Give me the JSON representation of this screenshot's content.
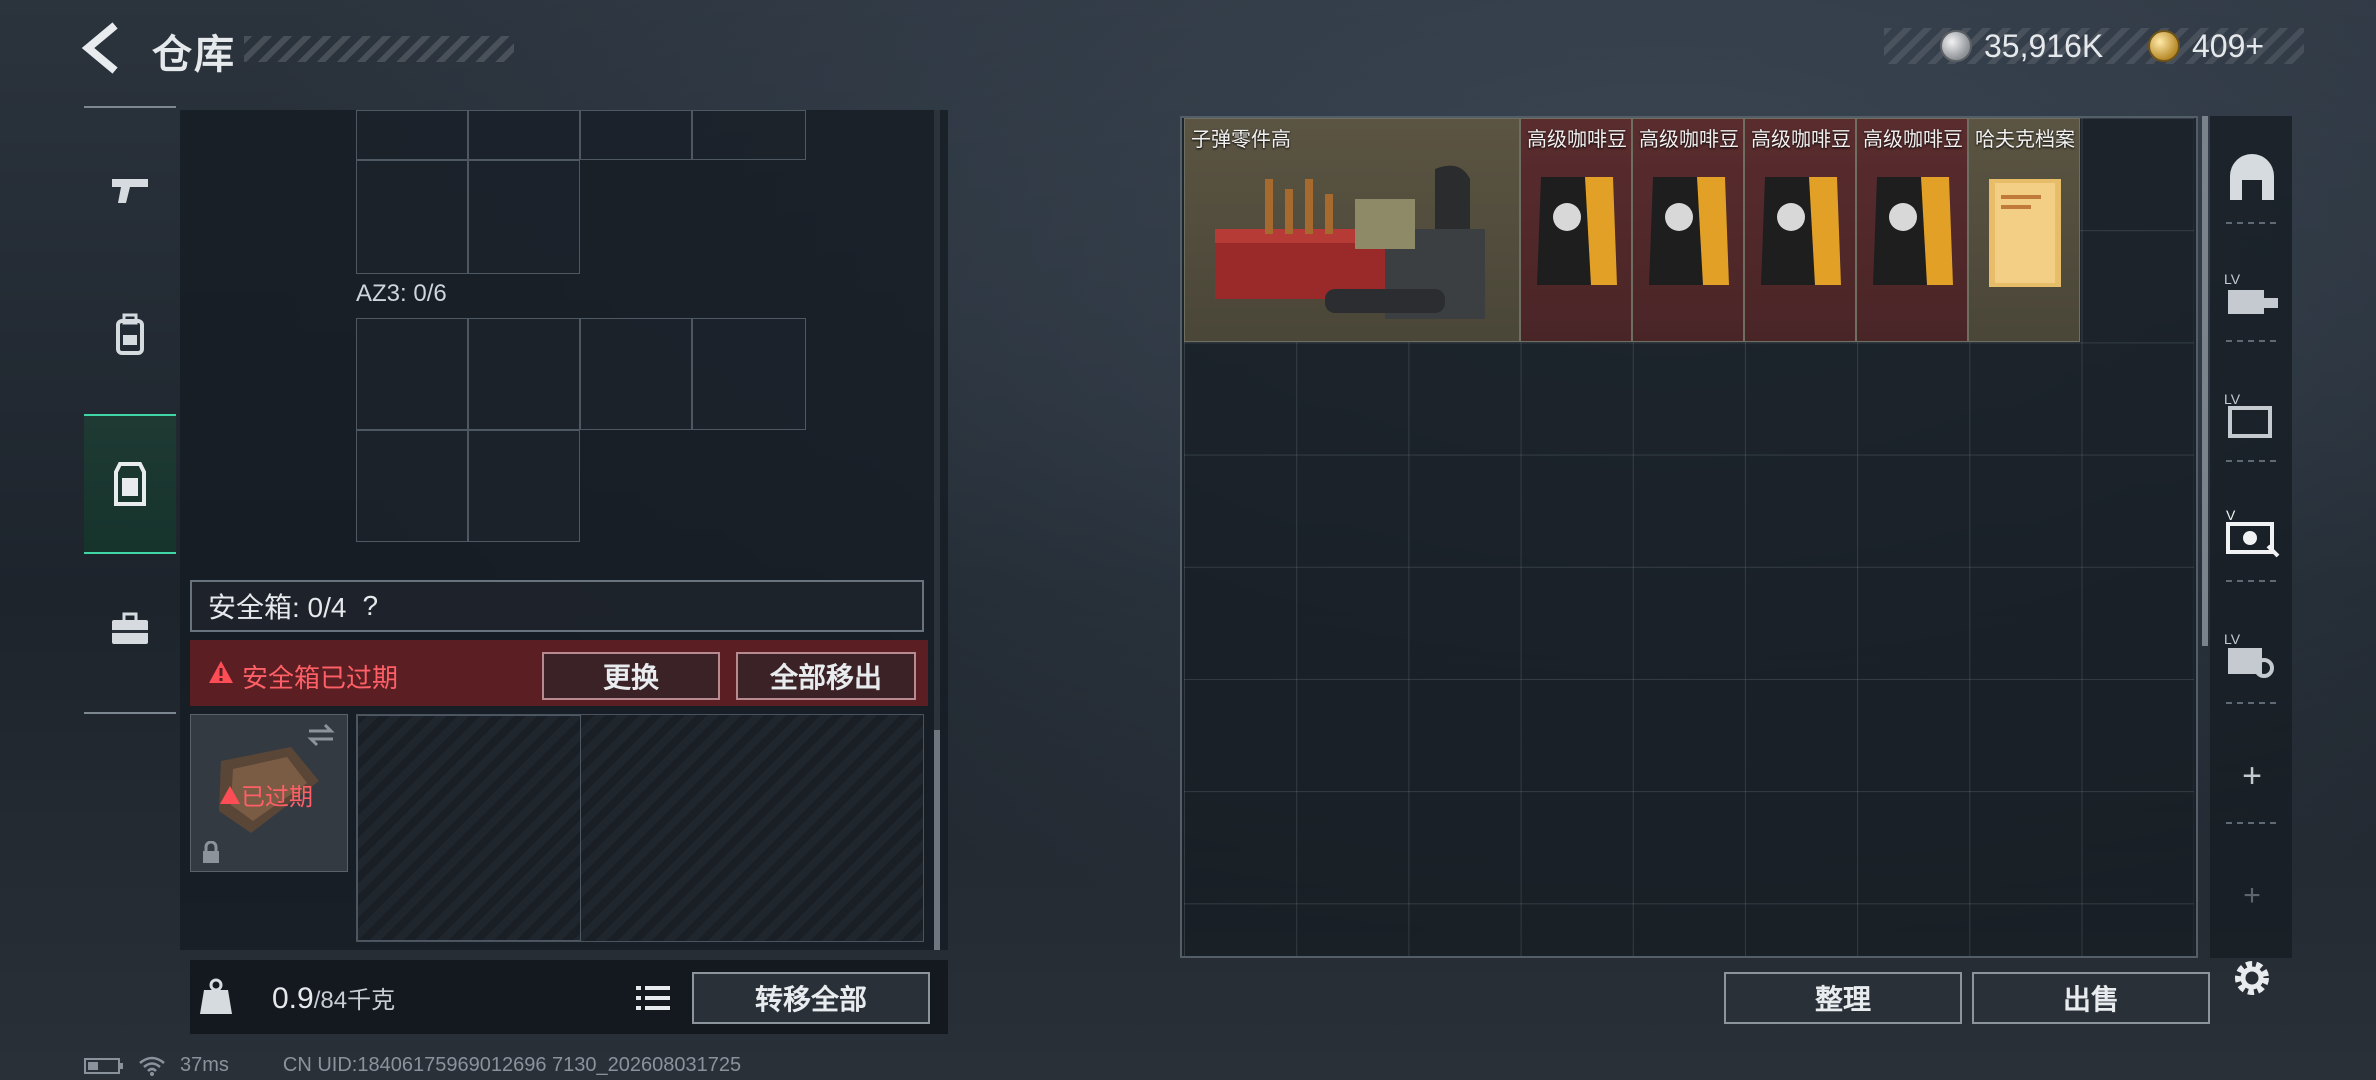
{
  "header": {
    "title": "仓库",
    "currency_silver": "35,916K",
    "currency_gold": "409+"
  },
  "left_tabs": [
    {
      "name": "weapon",
      "icon": "pistol-icon"
    },
    {
      "name": "gear",
      "icon": "backpack-icon"
    },
    {
      "name": "container",
      "icon": "vest-icon",
      "active": true
    },
    {
      "name": "case",
      "icon": "briefcase-icon"
    }
  ],
  "container": {
    "az3_label": "AZ3: 0/6",
    "safebox_label": "安全箱: 0/4",
    "safebox_help": "?",
    "expired_warning": "安全箱已过期",
    "replace_button": "更换",
    "move_all_out_button": "全部移出",
    "case_expired_label": "已过期"
  },
  "footer_left": {
    "weight_value": "0.9",
    "weight_max": "/84千克",
    "transfer_all_button": "转移全部"
  },
  "stash": {
    "items": [
      {
        "name": "子弹零件高",
        "rarity": "gold"
      },
      {
        "name": "高级咖啡豆",
        "rarity": "red"
      },
      {
        "name": "高级咖啡豆",
        "rarity": "red"
      },
      {
        "name": "高级咖啡豆",
        "rarity": "red"
      },
      {
        "name": "高级咖啡豆",
        "rarity": "red"
      },
      {
        "name": "哈夫克档案",
        "rarity": "gold"
      }
    ],
    "sort_button": "整理",
    "sell_button": "出售"
  },
  "right_tabs": [
    {
      "name": "arch-icon"
    },
    {
      "name": "lv-crate-icon",
      "badge": "LV"
    },
    {
      "name": "lv-folder-icon",
      "badge": "LV"
    },
    {
      "name": "lv-camera-icon",
      "badge": "V"
    },
    {
      "name": "lv-gear-icon",
      "badge": "LV"
    },
    {
      "name": "add-icon",
      "label": "+"
    },
    {
      "name": "add-icon-dim",
      "label": "+"
    }
  ],
  "status_bar": {
    "ping": "37ms",
    "uid": "CN UID:18406175969012696 7130_202608031725"
  },
  "colors": {
    "accent_green": "#3fd5a5",
    "warning_red": "#e5484d",
    "gold_rarity": "#5b5442",
    "red_rarity": "#5a2c2e"
  }
}
